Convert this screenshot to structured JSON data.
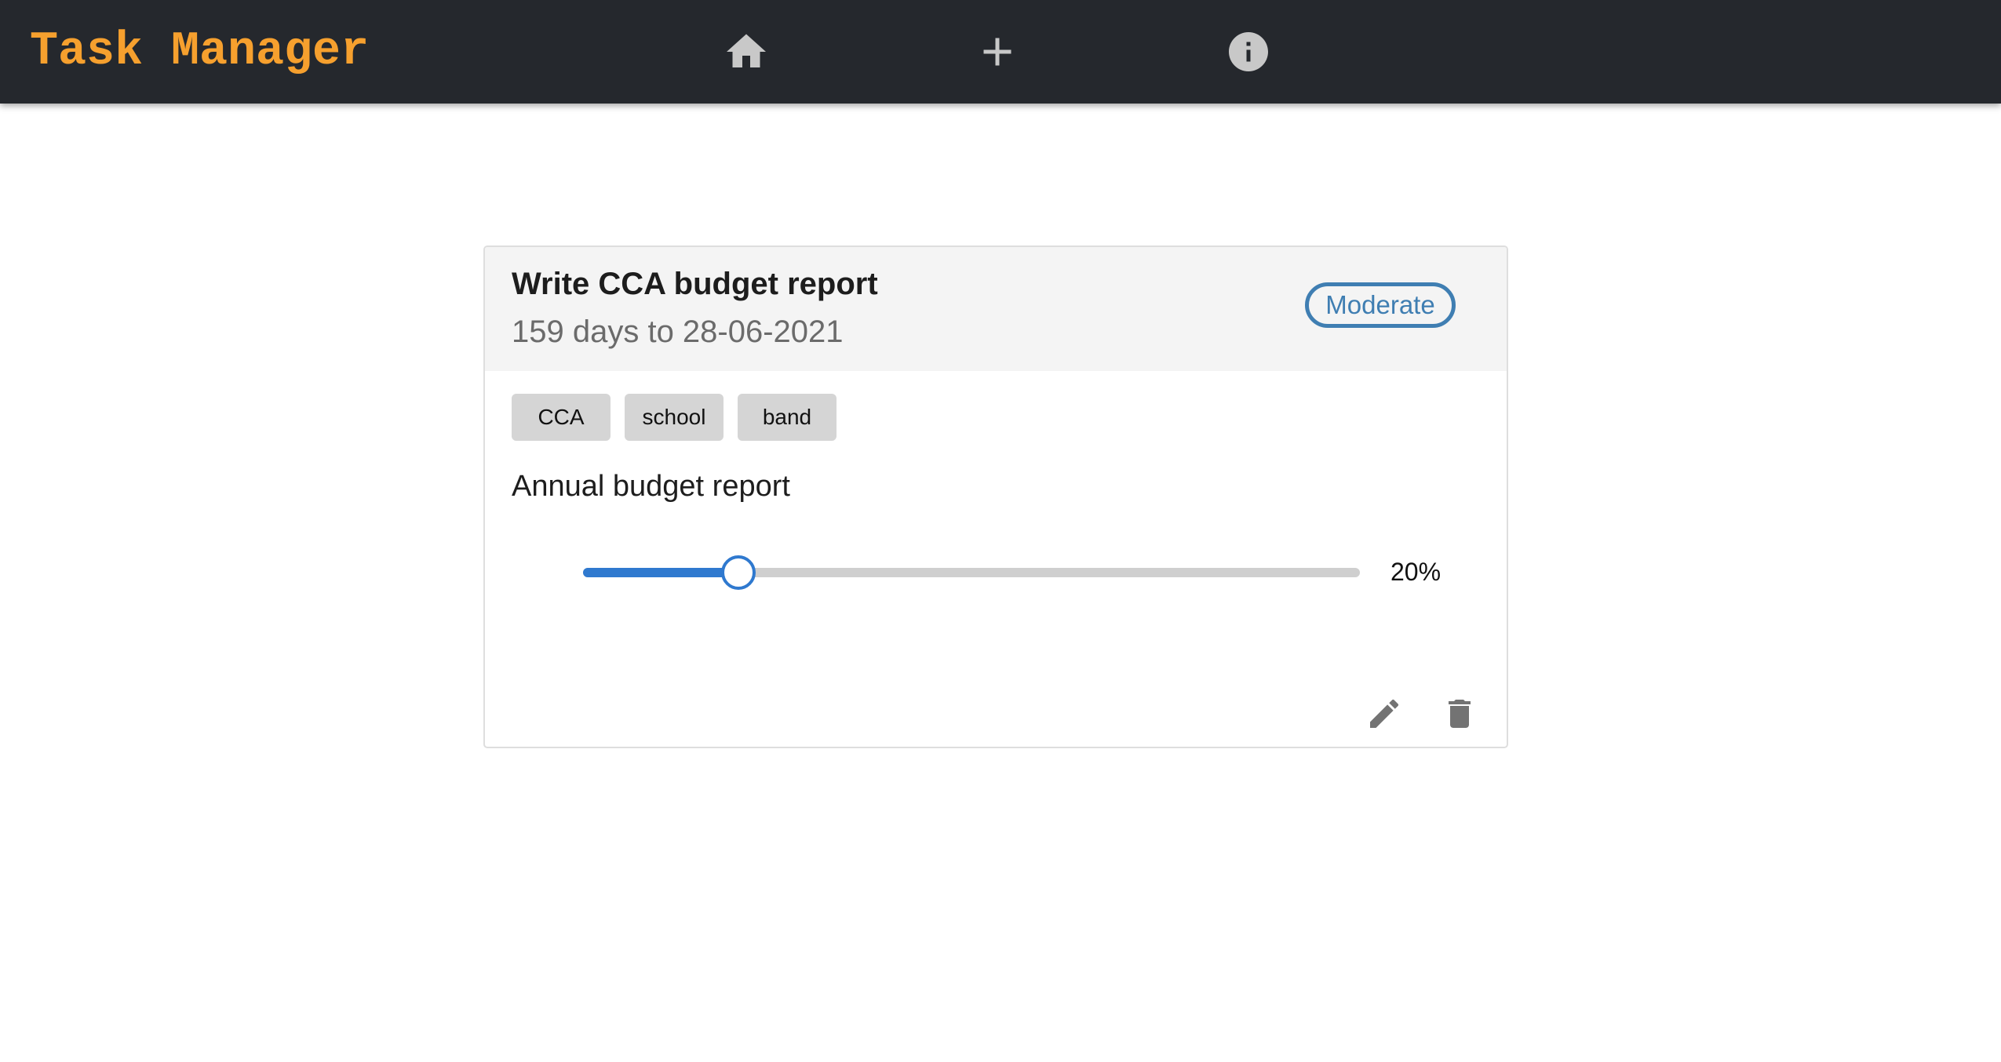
{
  "app": {
    "title": "Task Manager"
  },
  "nav": {
    "icons": [
      "home-icon",
      "plus-icon",
      "info-icon"
    ]
  },
  "task": {
    "title": "Write CCA budget report",
    "due_text": "159 days to 28-06-2021",
    "priority": "Moderate",
    "tags": [
      "CCA",
      "school",
      "band"
    ],
    "description": "Annual budget report",
    "progress": 20,
    "progress_label": "20%",
    "actions": [
      "edit-icon",
      "trash-icon"
    ]
  },
  "colors": {
    "navbar_bg": "#25282d",
    "brand": "#f6a02e",
    "accent": "#2f79cf",
    "priority": "#3f7eb2",
    "tag_bg": "#d5d5d5",
    "icon": "#737373"
  }
}
